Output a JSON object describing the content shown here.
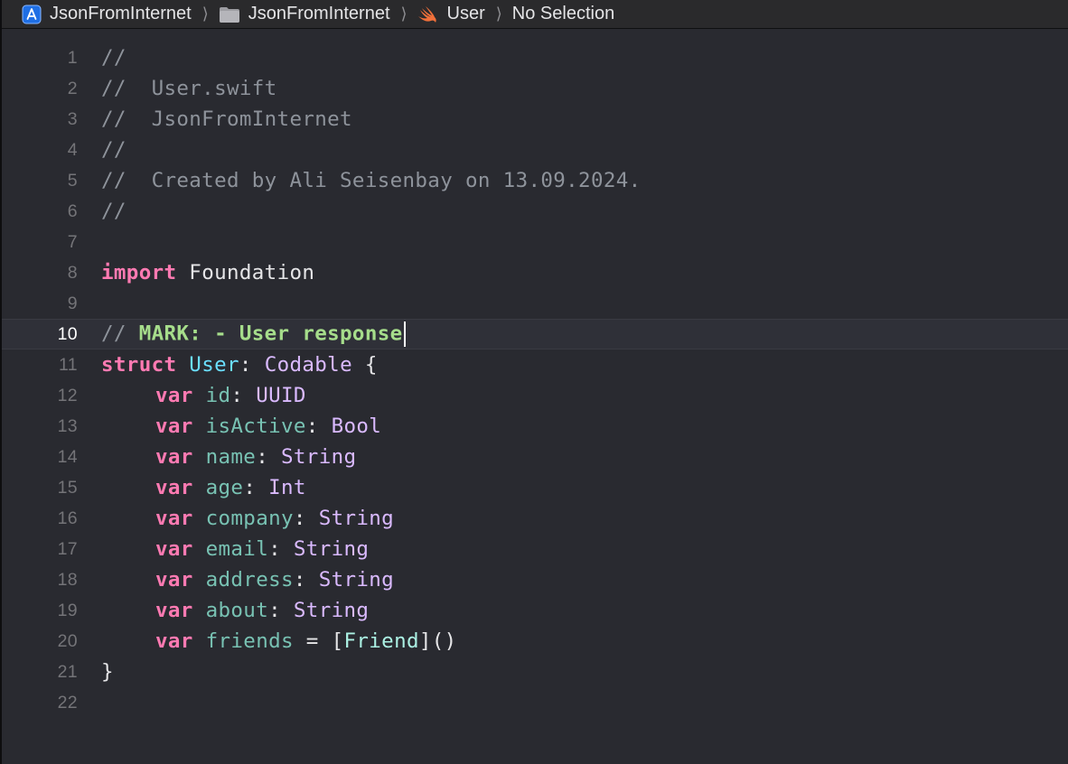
{
  "breadcrumb": {
    "project": "JsonFromInternet",
    "folder": "JsonFromInternet",
    "file": "User",
    "symbol": "No Selection",
    "icons": [
      "xcode-project-icon",
      "folder-icon",
      "swift-file-icon"
    ],
    "separator": "⟩"
  },
  "editor": {
    "current_line": 10,
    "lines": [
      {
        "n": "1",
        "text": "//"
      },
      {
        "n": "2",
        "text": "//  User.swift"
      },
      {
        "n": "3",
        "text": "//  JsonFromInternet"
      },
      {
        "n": "4",
        "text": "//"
      },
      {
        "n": "5",
        "text": "//  Created by Ali Seisenbay on 13.09.2024."
      },
      {
        "n": "6",
        "text": "//"
      },
      {
        "n": "7",
        "text": ""
      },
      {
        "n": "8",
        "import_kw": "import",
        "module": "Foundation"
      },
      {
        "n": "9",
        "text": ""
      },
      {
        "n": "10",
        "comment": "// ",
        "mark": "MARK: - User response"
      },
      {
        "n": "11",
        "struct_kw": "struct",
        "name": "User",
        "colon": ":",
        "protocol": "Codable",
        "brace": "{"
      },
      {
        "n": "12",
        "kw": "var",
        "prop": "id",
        "colon": ":",
        "type": "UUID"
      },
      {
        "n": "13",
        "kw": "var",
        "prop": "isActive",
        "colon": ":",
        "type": "Bool"
      },
      {
        "n": "14",
        "kw": "var",
        "prop": "name",
        "colon": ":",
        "type": "String"
      },
      {
        "n": "15",
        "kw": "var",
        "prop": "age",
        "colon": ":",
        "type": "Int"
      },
      {
        "n": "16",
        "kw": "var",
        "prop": "company",
        "colon": ":",
        "type": "String"
      },
      {
        "n": "17",
        "kw": "var",
        "prop": "email",
        "colon": ":",
        "type": "String"
      },
      {
        "n": "18",
        "kw": "var",
        "prop": "address",
        "colon": ":",
        "type": "String"
      },
      {
        "n": "19",
        "kw": "var",
        "prop": "about",
        "colon": ":",
        "type": "String"
      },
      {
        "n": "20",
        "kw": "var",
        "prop": "friends",
        "eq": " = [",
        "type": "Friend",
        "tail": "]()"
      },
      {
        "n": "21",
        "text": "}"
      },
      {
        "n": "22",
        "text": ""
      }
    ]
  },
  "colors": {
    "background": "#292a30",
    "comment": "#8e939b",
    "mark": "#a6dd8b",
    "keyword": "#ff7ab2",
    "type_declaration": "#6bdfff",
    "type": "#dabaff",
    "property": "#78c2b3",
    "plain": "#e6e6e8"
  }
}
